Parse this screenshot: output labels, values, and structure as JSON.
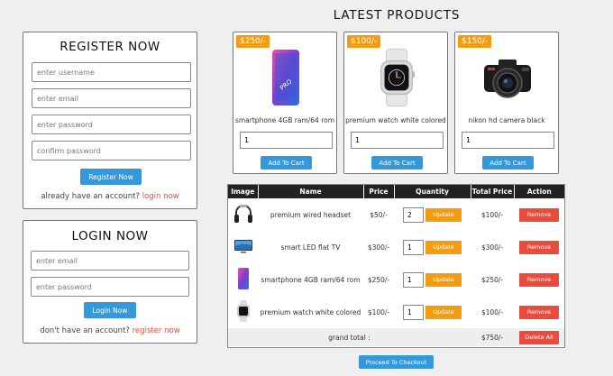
{
  "register": {
    "title": "REGISTER NOW",
    "username_placeholder": "enter username",
    "email_placeholder": "enter email",
    "password_placeholder": "enter password",
    "confirm_placeholder": "confirm password",
    "button": "Register Now",
    "footer_text": "already have an account?",
    "footer_link": "login now"
  },
  "login": {
    "title": "LOGIN NOW",
    "email_placeholder": "enter email",
    "password_placeholder": "enter password",
    "button": "Login Now",
    "footer_text": "don't have an account?",
    "footer_link": "register now"
  },
  "products": {
    "title": "LATEST PRODUCTS",
    "items": [
      {
        "price": "$250/-",
        "name": "smartphone 4GB ram/64 rom",
        "qty": "1",
        "button": "Add To Cart",
        "icon": "smartphone-icon"
      },
      {
        "price": "$100/-",
        "name": "premium watch white colored",
        "qty": "1",
        "button": "Add To Cart",
        "icon": "watch-icon"
      },
      {
        "price": "$150/-",
        "name": "nikon hd camera black",
        "qty": "1",
        "button": "Add To Cart",
        "icon": "camera-icon"
      }
    ]
  },
  "cart": {
    "headers": [
      "Image",
      "Name",
      "Price",
      "Quantity",
      "Total Price",
      "Action"
    ],
    "rows": [
      {
        "icon": "headphones-icon",
        "name": "premium wired headset",
        "price": "$50/-",
        "qty": "2",
        "update": "Update",
        "total": "$100/-",
        "remove": "Remove"
      },
      {
        "icon": "tv-icon",
        "name": "smart LED flat TV",
        "price": "$300/-",
        "qty": "1",
        "update": "Update",
        "total": "$300/-",
        "remove": "Remove"
      },
      {
        "icon": "smartphone-icon",
        "name": "smartphone 4GB ram/64 rom",
        "price": "$250/-",
        "qty": "1",
        "update": "Update",
        "total": "$250/-",
        "remove": "Remove"
      },
      {
        "icon": "watch-icon",
        "name": "premium watch white colored",
        "price": "$100/-",
        "qty": "1",
        "update": "Update",
        "total": "$100/-",
        "remove": "Remove"
      }
    ],
    "grand_total_label": "grand total :",
    "grand_total_value": "$750/-",
    "delete_all": "Delete All",
    "checkout": "Proceed To Checkout"
  },
  "colors": {
    "primary": "#3498db",
    "accent": "#f39c12",
    "danger": "#e74c3c",
    "header_bg": "#222222"
  }
}
